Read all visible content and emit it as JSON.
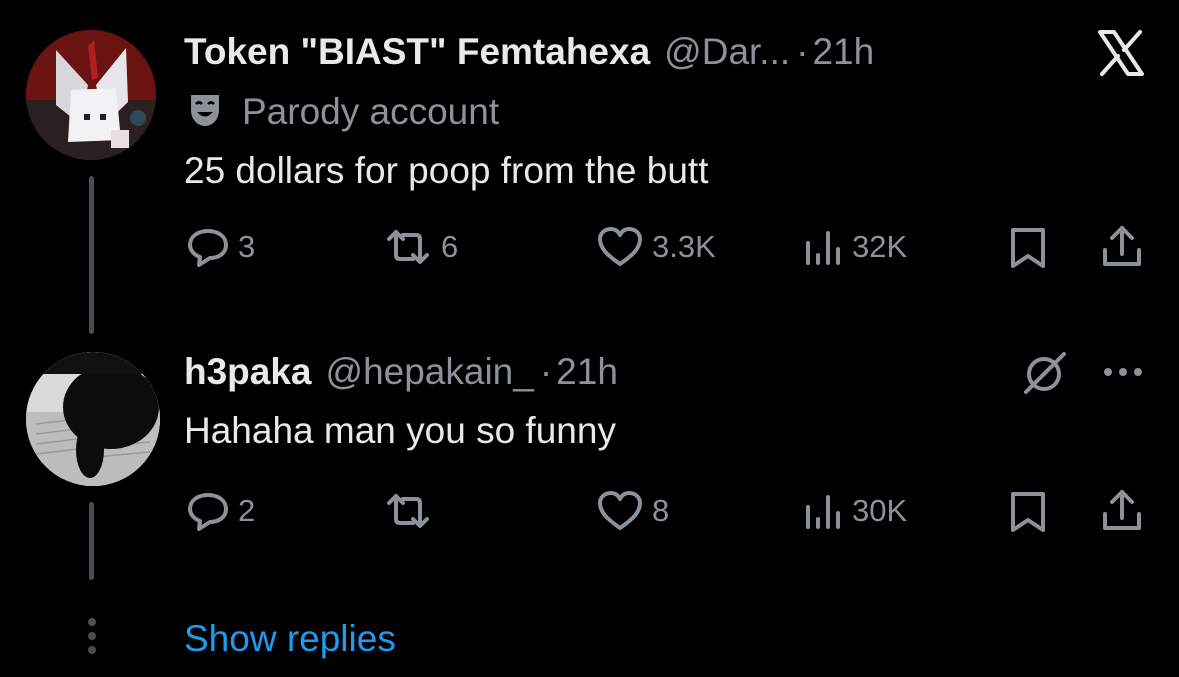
{
  "tweets": [
    {
      "display_name": "Token \"BIAST\" Femtahexa",
      "handle": "@Dar...",
      "separator": "·",
      "time": "21h",
      "badge_text": "Parody account",
      "text": "25 dollars for poop from the butt",
      "replies": "3",
      "reposts": "6",
      "likes": "3.3K",
      "views": "32K"
    },
    {
      "display_name": "h3paka",
      "handle": "@hepakain_",
      "separator": "·",
      "time": "21h",
      "text": "Hahaha man you so funny",
      "replies": "2",
      "reposts": "",
      "likes": "8",
      "views": "30K"
    }
  ],
  "show_replies_label": "Show replies",
  "icons": {
    "top_right": "x-logo-icon",
    "badge": "theater-mask-icon",
    "grok": "grok-icon",
    "more": "more-icon",
    "collapsed_thread": "dotted-thread-icon"
  },
  "colors": {
    "background": "#000000",
    "primary_text": "#e7e9ea",
    "secondary_text": "#8b9298",
    "link": "#1d9bf0",
    "thread_line": "#4a4f53"
  }
}
